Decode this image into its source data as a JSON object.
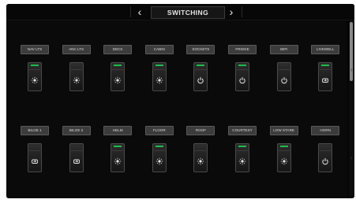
{
  "header": {
    "title": "SWITCHING",
    "prev_glyph": "‹",
    "next_glyph": "›"
  },
  "colors": {
    "led_on": "#1dbd4a",
    "led_off": "#2e2e2e",
    "label_bg": "#3c3c3c"
  },
  "switches": [
    {
      "label": "NAV LTS",
      "icon": "light-icon",
      "led": "on"
    },
    {
      "label": "ANC LTS",
      "icon": "light-icon",
      "led": "off"
    },
    {
      "label": "DECK",
      "icon": "light-icon",
      "led": "on"
    },
    {
      "label": "CABIN",
      "icon": "light-icon",
      "led": "on"
    },
    {
      "label": "SOCKETS",
      "icon": "power-icon",
      "led": "on"
    },
    {
      "label": "FRIDGE",
      "icon": "power-icon",
      "led": "on"
    },
    {
      "label": "WIFI",
      "icon": "power-icon",
      "led": "off"
    },
    {
      "label": "LIVEWELL",
      "icon": "pump-icon",
      "led": "on"
    },
    {
      "label": "BILGE 1",
      "icon": "pump-icon",
      "led": "off"
    },
    {
      "label": "BILGE 2",
      "icon": "pump-icon",
      "led": "off"
    },
    {
      "label": "HELM",
      "icon": "light-icon",
      "led": "on"
    },
    {
      "label": "FLOOR",
      "icon": "light-icon",
      "led": "on"
    },
    {
      "label": "ROOF",
      "icon": "light-icon",
      "led": "off"
    },
    {
      "label": "COURTESY",
      "icon": "light-icon",
      "led": "on"
    },
    {
      "label": "LOW STARE",
      "icon": "light-icon",
      "led": "on"
    },
    {
      "label": "HORN",
      "icon": "power-icon",
      "led": "off"
    }
  ]
}
